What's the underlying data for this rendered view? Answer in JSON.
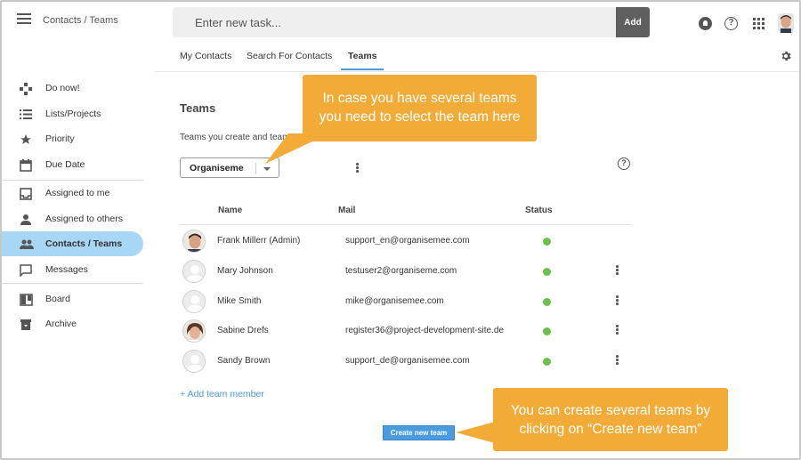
{
  "header": {
    "breadcrumb": "Contacts / Teams",
    "task_placeholder": "Enter new task...",
    "add_label": "Add",
    "help_glyph": "?"
  },
  "tabs": [
    {
      "label": "My Contacts",
      "active": false
    },
    {
      "label": "Search For Contacts",
      "active": false
    },
    {
      "label": "Teams",
      "active": true
    }
  ],
  "sidebar": {
    "items": [
      {
        "label": "Do now!",
        "icon": "gamepad-icon"
      },
      {
        "label": "Lists/Projects",
        "icon": "list-icon"
      },
      {
        "label": "Priority",
        "icon": "star-icon"
      },
      {
        "label": "Due Date",
        "icon": "calendar-icon"
      },
      {
        "label": "Assigned to me",
        "icon": "inbox-icon"
      },
      {
        "label": "Assigned to others",
        "icon": "person-icon"
      },
      {
        "label": "Contacts / Teams",
        "icon": "people-icon",
        "active": true
      },
      {
        "label": "Messages",
        "icon": "message-icon"
      },
      {
        "label": "Board",
        "icon": "board-icon"
      },
      {
        "label": "Archive",
        "icon": "archive-icon"
      }
    ]
  },
  "main": {
    "title": "Teams",
    "subtitle": "Teams you create and teams",
    "selected_team": "Organiseme",
    "help_glyph": "?",
    "columns": {
      "name": "Name",
      "mail": "Mail",
      "status": "Status"
    },
    "members": [
      {
        "name": "Frank Millerr (Admin)",
        "mail": "support_en@organisemee.com",
        "status": "online",
        "avatar": "photo",
        "menu": false
      },
      {
        "name": "Mary Johnson",
        "mail": "testuser2@organiseme.com",
        "status": "online",
        "avatar": "placeholder",
        "menu": true
      },
      {
        "name": "Mike Smith",
        "mail": "mike@organisemee.com",
        "status": "online",
        "avatar": "placeholder",
        "menu": true
      },
      {
        "name": "Sabine Drefs",
        "mail": "register36@project-development-site.de",
        "status": "online",
        "avatar": "photo",
        "menu": true
      },
      {
        "name": "Sandy Brown",
        "mail": "support_de@organisemee.com",
        "status": "online",
        "avatar": "placeholder",
        "menu": true
      }
    ],
    "add_member_label": "+ Add team member",
    "create_team_label": "Create new team"
  },
  "callouts": {
    "select_team_line1": "In case you have several teams",
    "select_team_line2": "you need to select the team here",
    "create_team_line1": "You can create several teams by",
    "create_team_line2": "clicking on “Create new team”"
  },
  "colors": {
    "accent": "#4a9be0",
    "active_nav": "#a8d6f5",
    "callout": "#f2ab37",
    "status_online": "#6cc04a",
    "add_button": "#5f5f5f"
  }
}
